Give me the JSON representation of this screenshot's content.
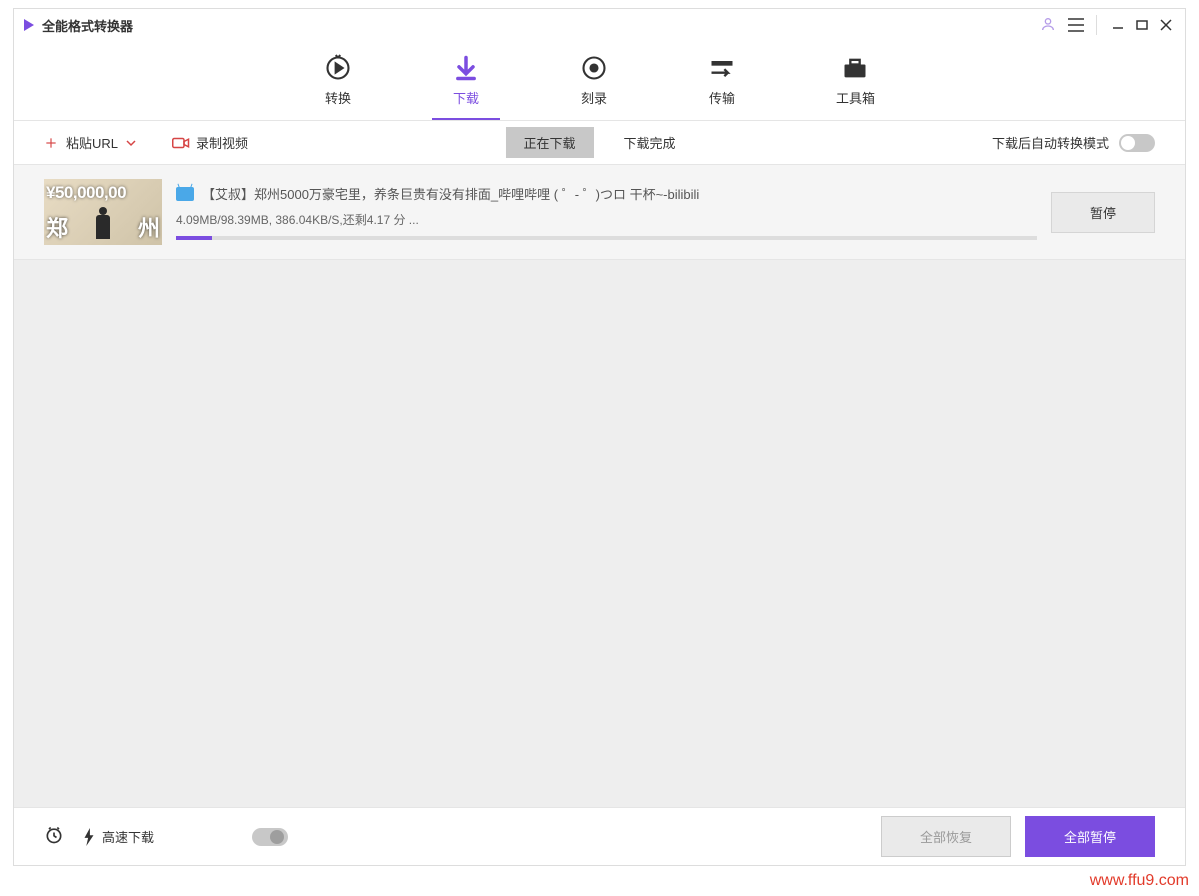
{
  "app": {
    "title": "全能格式转换器"
  },
  "mainTabs": {
    "convert": "转换",
    "download": "下载",
    "burn": "刻录",
    "transfer": "传输",
    "toolbox": "工具箱"
  },
  "subBar": {
    "pasteUrl": "粘贴URL",
    "recordVideo": "录制视频",
    "downloading": "正在下载",
    "downloaded": "下载完成",
    "autoConvert": "下载后自动转换模式"
  },
  "item": {
    "title": "【艾叔】郑州5000万豪宅里，养条巨贵有没有排面_哔哩哔哩 ( ゜- ゜)つロ  干杯~-bilibili",
    "stats": "4.09MB/98.39MB, 386.04KB/S,还剩4.17 分 ...",
    "pause": "暂停",
    "thumbPrice": "¥50,000,00",
    "thumbLeft": "郑",
    "thumbRight": "州"
  },
  "footer": {
    "speedLabel": "高速下载",
    "resumeAll": "全部恢复",
    "pauseAll": "全部暂停"
  },
  "watermark": "www.ffu9.com"
}
